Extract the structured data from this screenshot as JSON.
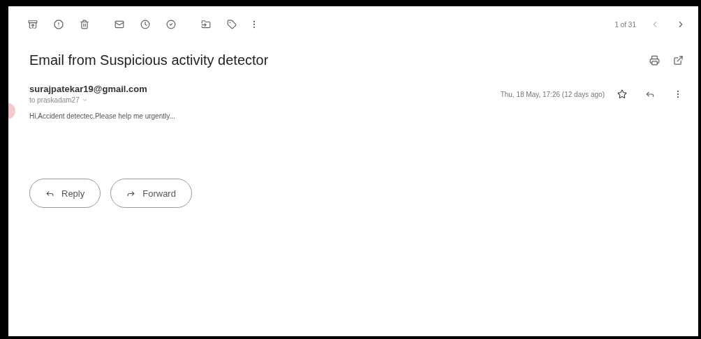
{
  "pager": "1 of 31",
  "subject": "Email from Suspicious activity detector",
  "message": {
    "sender": "surajpatekar19@gmail.com",
    "recipient": "to praskadam27",
    "date": "Thu, 18 May, 17:26 (12 days ago)",
    "starred": false,
    "body": "Hi,Accident detectec.Please help me urgently..."
  },
  "buttons": [
    {
      "kind": "reply",
      "label": "Reply"
    },
    {
      "kind": "forward",
      "label": "Forward"
    }
  ]
}
